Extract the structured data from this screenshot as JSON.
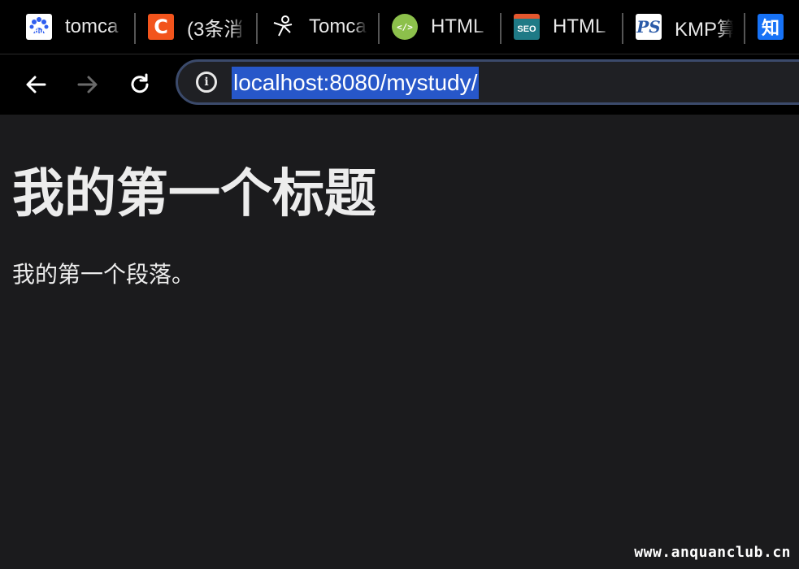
{
  "tabs": [
    {
      "label": "tomca",
      "icon": "baidu-paw-icon",
      "color": "#2f5ef0",
      "glyph": "du"
    },
    {
      "label": "(3条消",
      "icon": "csdn-c-icon",
      "color": "#f2541c",
      "glyph": "C"
    },
    {
      "label": "Tomca",
      "icon": "stickfigure-icon",
      "color": "#000000",
      "glyph": "⚲"
    },
    {
      "label": "HTML",
      "icon": "code-leaf-icon",
      "color": "#8cc04b",
      "glyph": "</>"
    },
    {
      "label": "HTML",
      "icon": "seo-icon",
      "color": "#1f7a86",
      "glyph": "SEO"
    },
    {
      "label": "KMP算",
      "icon": "ps-icon",
      "color": "#ffffff",
      "glyph": "PS"
    },
    {
      "label": "",
      "icon": "zhihu-icon",
      "color": "#1772f6",
      "glyph": "知"
    }
  ],
  "toolbar": {
    "url": "localhost:8080/mystudy/"
  },
  "page": {
    "heading": "我的第一个标题",
    "paragraph": "我的第一个段落。"
  },
  "watermark": "www.anquanclub.cn"
}
